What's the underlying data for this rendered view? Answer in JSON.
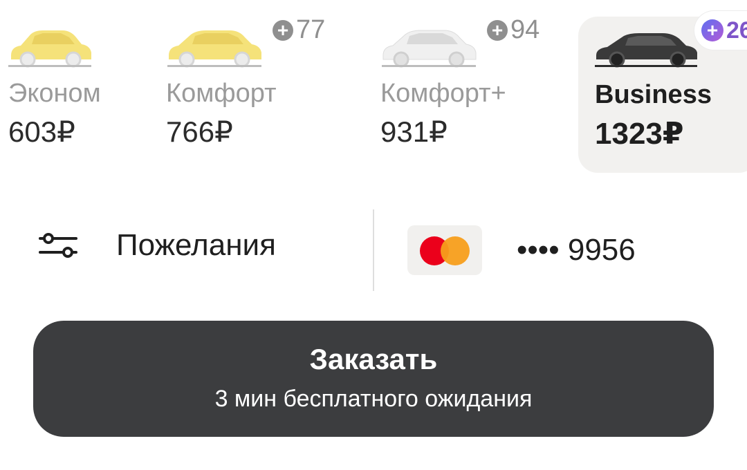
{
  "tariffs": [
    {
      "id": "econom",
      "name": "Эконом",
      "price": "603₽",
      "car_color": "#f5e27a",
      "selected": false
    },
    {
      "id": "comfort",
      "name": "Комфорт",
      "price": "766₽",
      "car_color": "#f5e27a",
      "selected": false,
      "plus_points": "77"
    },
    {
      "id": "comfort_plus",
      "name": "Комфорт+",
      "price": "931₽",
      "car_color": "#eeeeee",
      "selected": false,
      "plus_points": "94"
    },
    {
      "id": "business",
      "name": "Business",
      "price": "1323₽",
      "car_color": "#3a3a3a",
      "selected": true,
      "cashback": "26"
    }
  ],
  "options": {
    "wishes_label": "Пожелания",
    "wishes_icon": "sliders-icon"
  },
  "payment": {
    "card_brand": "mastercard",
    "card_number": "•••• 9956"
  },
  "order_button": {
    "title": "Заказать",
    "subtitle": "3 мин бесплатного ожидания"
  },
  "colors": {
    "button_bg": "#3c3d3f",
    "selected_tile_bg": "#f2f1ef",
    "cashback_accent": "#7e55c9",
    "plus_badge": "#8f8f8f"
  }
}
